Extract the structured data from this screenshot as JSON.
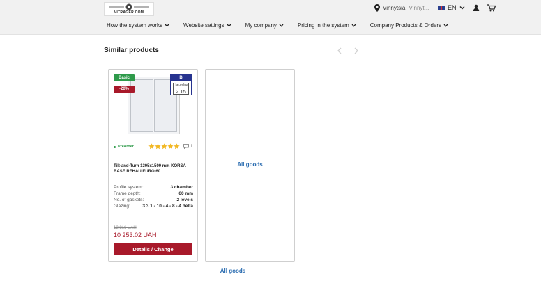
{
  "header": {
    "logo_text": "VITRAGER.COM",
    "location": {
      "city": "Vinnytsia,",
      "region": "Vinnyt..."
    },
    "language": "EN",
    "icons": {
      "location": "pin-icon",
      "profile": "user-icon",
      "cart": "cart-icon"
    }
  },
  "nav": [
    {
      "label": "How the system works"
    },
    {
      "label": "Website settings"
    },
    {
      "label": "My company"
    },
    {
      "label": "Pricing in the system"
    },
    {
      "label": "Company Products & Orders"
    }
  ],
  "section": {
    "title": "Similar products"
  },
  "product": {
    "badge_type": "Basic",
    "badge_discount": "-20%",
    "energy_class": "B",
    "uw_label": "Uw-value",
    "uw_value": "2.15",
    "status": "Preorder",
    "rating": 5,
    "comments_count": "1",
    "name": "Tilt-and-Turn 1305x1500 mm KORSA BASE REHAU EURO 60...",
    "specs": [
      {
        "label": "Profile system:",
        "value": "3 chamber"
      },
      {
        "label": "Frame depth:",
        "value": "60 mm"
      },
      {
        "label": "No. of gaskets:",
        "value": "2 levels"
      },
      {
        "label": "Glazing:",
        "value": "3.3.1 - 10 - 4 - 8 - 4 delta"
      }
    ],
    "old_price": "12 816 UAH",
    "price": "10 253.02 UAH",
    "cta_label": "Details / Change"
  },
  "all_goods_card": {
    "label": "All goods"
  },
  "all_goods_link": {
    "label": "All goods"
  },
  "colors": {
    "accent_red": "#a8192a",
    "badge_green": "#2e9a4a",
    "energy_blue": "#26338f",
    "link_blue": "#2a6cb0",
    "star_gold": "#f2b824"
  }
}
